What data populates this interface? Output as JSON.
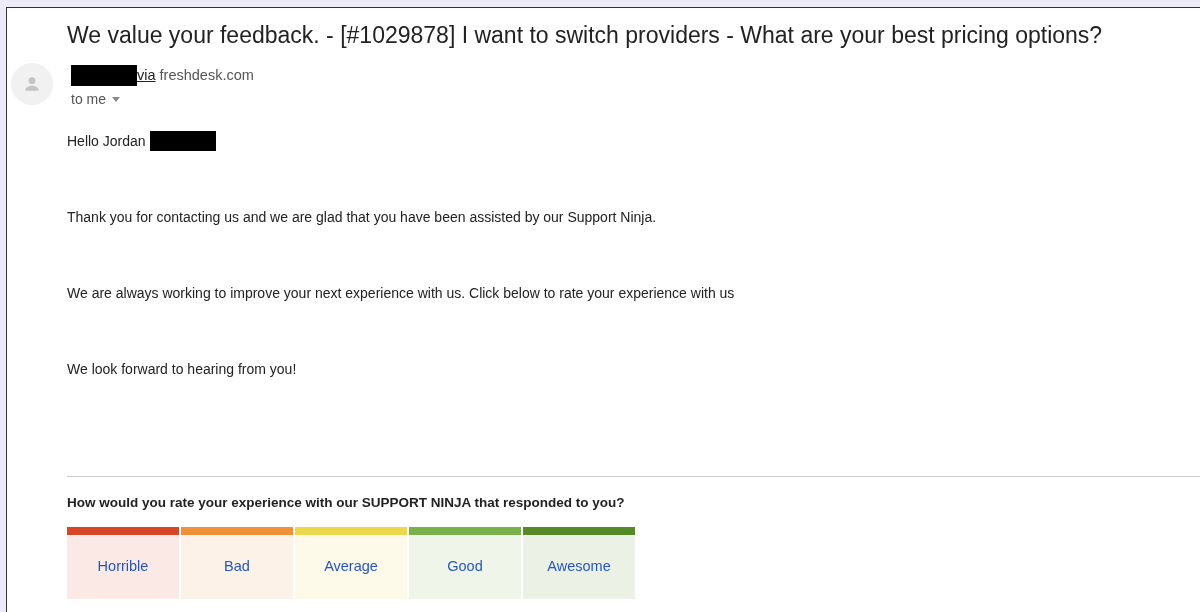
{
  "subject": "We value your feedback. - [#1029878] I want to switch providers - What are your best pricing options?",
  "sender": {
    "via": "via",
    "domain": "freshdesk.com",
    "recipient": "to me"
  },
  "body": {
    "greeting": "Hello Jordan",
    "paragraphs": [
      "Thank you for contacting us and we are glad that you have been assisted by our Support Ninja.",
      "We are always working to improve your next experience with us. Click below to rate your experience with us",
      "We look forward to hearing from you!"
    ]
  },
  "survey": {
    "question": "How would you rate your experience with our SUPPORT NINJA that responded to you?",
    "options": [
      {
        "label": "Horrible",
        "color": "#d64527"
      },
      {
        "label": "Bad",
        "color": "#f0913a"
      },
      {
        "label": "Average",
        "color": "#ebd84c"
      },
      {
        "label": "Good",
        "color": "#78b04a"
      },
      {
        "label": "Awesome",
        "color": "#568a28"
      }
    ]
  }
}
